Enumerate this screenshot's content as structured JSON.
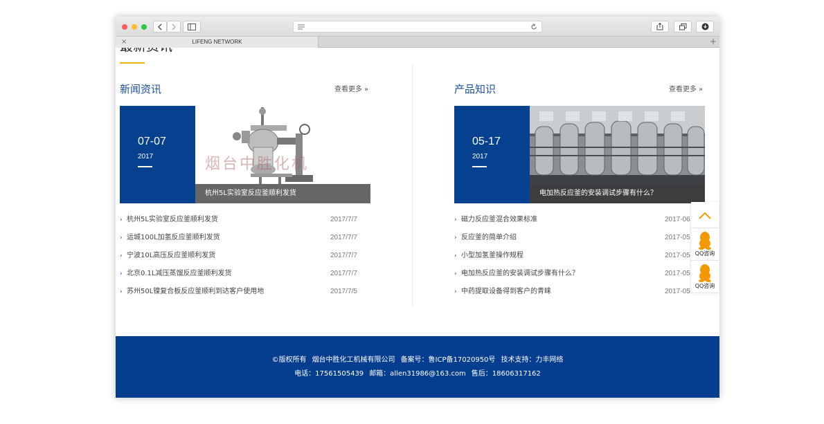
{
  "browser": {
    "tab_title": "LIFENG NETWORK",
    "tab_close": "×",
    "new_tab": "+"
  },
  "section": {
    "title": "最新资讯"
  },
  "news": {
    "title": "新闻资讯",
    "more": "查看更多",
    "more_chevron": "»",
    "feature": {
      "date": "07-07",
      "year": "2017",
      "watermark": "烟台中胜化机",
      "caption": "杭州5L实验室反应釜顺利发货"
    },
    "items": [
      {
        "title": "杭州5L实验室反应釜顺利发货",
        "date": "2017/7/7"
      },
      {
        "title": "运城100L加氢反应釜顺利发货",
        "date": "2017/7/7"
      },
      {
        "title": "宁波10L高压反应釜顺利发货",
        "date": "2017/7/7"
      },
      {
        "title": "北京0.1L减压蒸馏反应釜顺利发货",
        "date": "2017/7/7"
      },
      {
        "title": "苏州50L镍复合板反应釜顺利到达客户使用地",
        "date": "2017/7/5"
      }
    ]
  },
  "knowledge": {
    "title": "产品知识",
    "more": "查看更多",
    "more_chevron": "»",
    "feature": {
      "date": "05-17",
      "year": "2017",
      "caption": "电加热反应釜的安装调试步骤有什么？"
    },
    "items": [
      {
        "title": "磁力反应釜混合效果标准",
        "date": "2017-06"
      },
      {
        "title": "反应釜的简单介绍",
        "date": "2017-05"
      },
      {
        "title": "小型加氢釜操作规程",
        "date": "2017-05"
      },
      {
        "title": "电加热反应釜的安装调试步骤有什么？",
        "date": "2017-05"
      },
      {
        "title": "中药提取设备得到客户的青睐",
        "date": "2017-05"
      }
    ]
  },
  "footer": {
    "copyright": "©版权所有",
    "company": "烟台中胜化工机械有限公司",
    "icp": "备案号：鲁ICP备17020950号",
    "support": "技术支持：力丰网络",
    "phone": "电话：17561505439",
    "email": "邮箱：allen31986@163.com",
    "after_sales": "售后：18606317162"
  },
  "side_widget": {
    "qq1": "QQ咨询",
    "qq2": "QQ咨询",
    "accent": "#f39800"
  },
  "colors": {
    "brand_blue": "#06418f",
    "title_blue": "#1c4fa0",
    "underline_yellow": "#f3b400"
  }
}
